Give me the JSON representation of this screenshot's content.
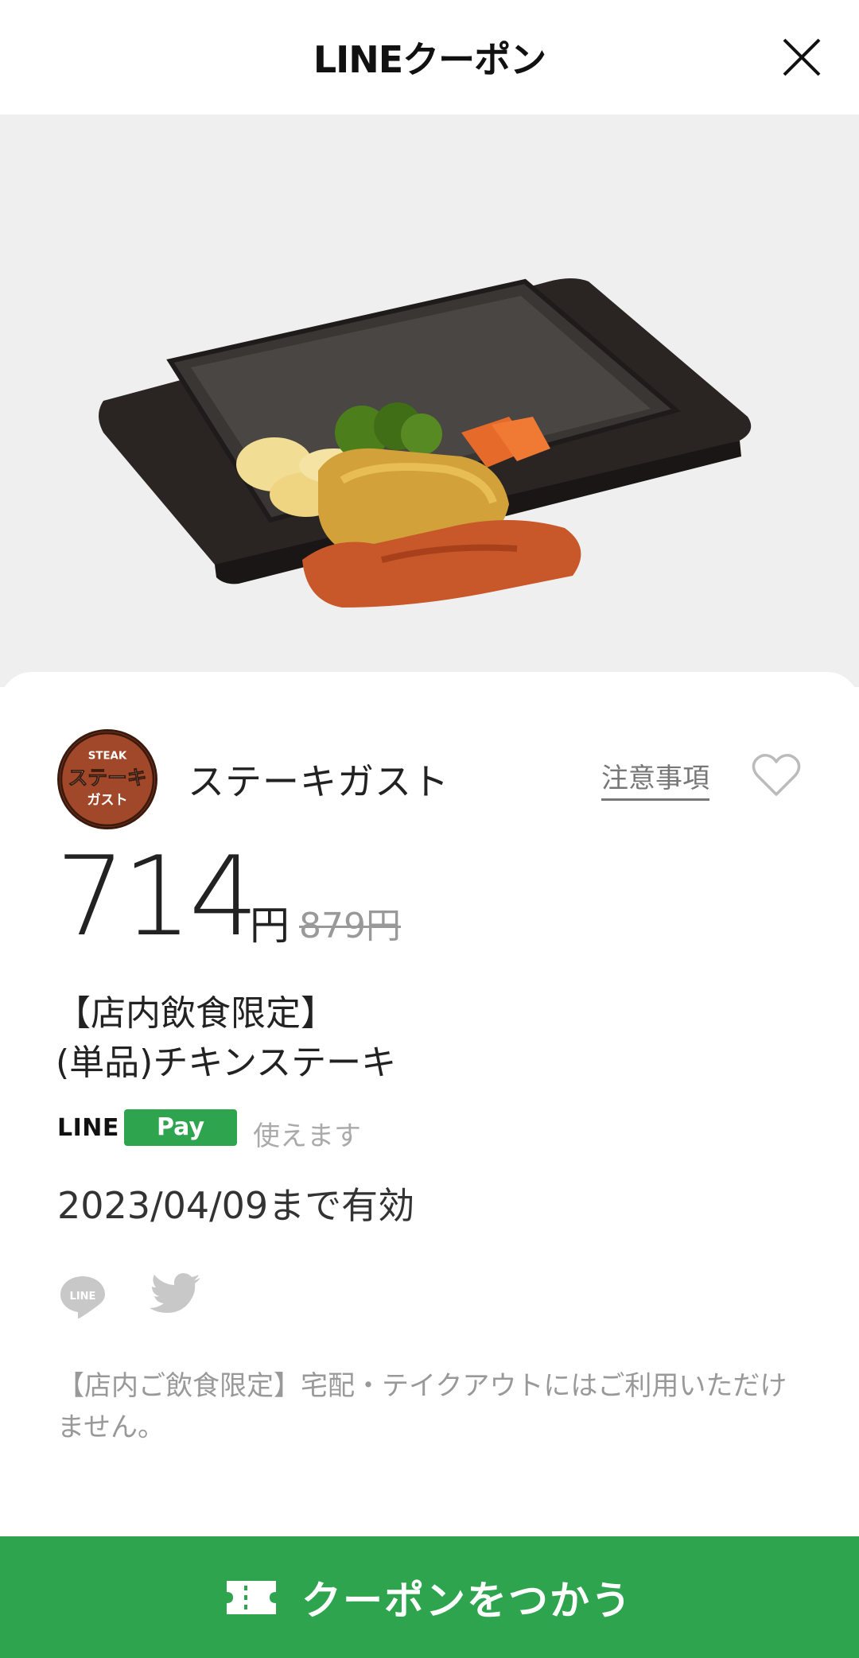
{
  "header": {
    "title": "LINEクーポン"
  },
  "brand": {
    "name": "ステーキガスト",
    "logo_top": "STEAK",
    "logo_mid": "ステーキ",
    "logo_bottom": "ガスト"
  },
  "links": {
    "notes": "注意事項"
  },
  "price": {
    "current": "714",
    "unit": "円",
    "original": "879円"
  },
  "coupon": {
    "title_line1": "【店内飲食限定】",
    "title_line2": "(単品)チキンステーキ"
  },
  "payment": {
    "line_label": "LINE",
    "badge": "Pay",
    "usable": "使えます"
  },
  "validity": "2023/04/09まで有効",
  "share": {
    "line_icon_text": "LINE"
  },
  "notice": "【店内ご飲食限定】宅配・テイクアウトにはご利用いただけません。",
  "cta": {
    "label": "クーポンをつかう"
  },
  "colors": {
    "accent": "#2ea44f",
    "hero_bg": "#efefef",
    "logo_bg": "#a2482a"
  }
}
